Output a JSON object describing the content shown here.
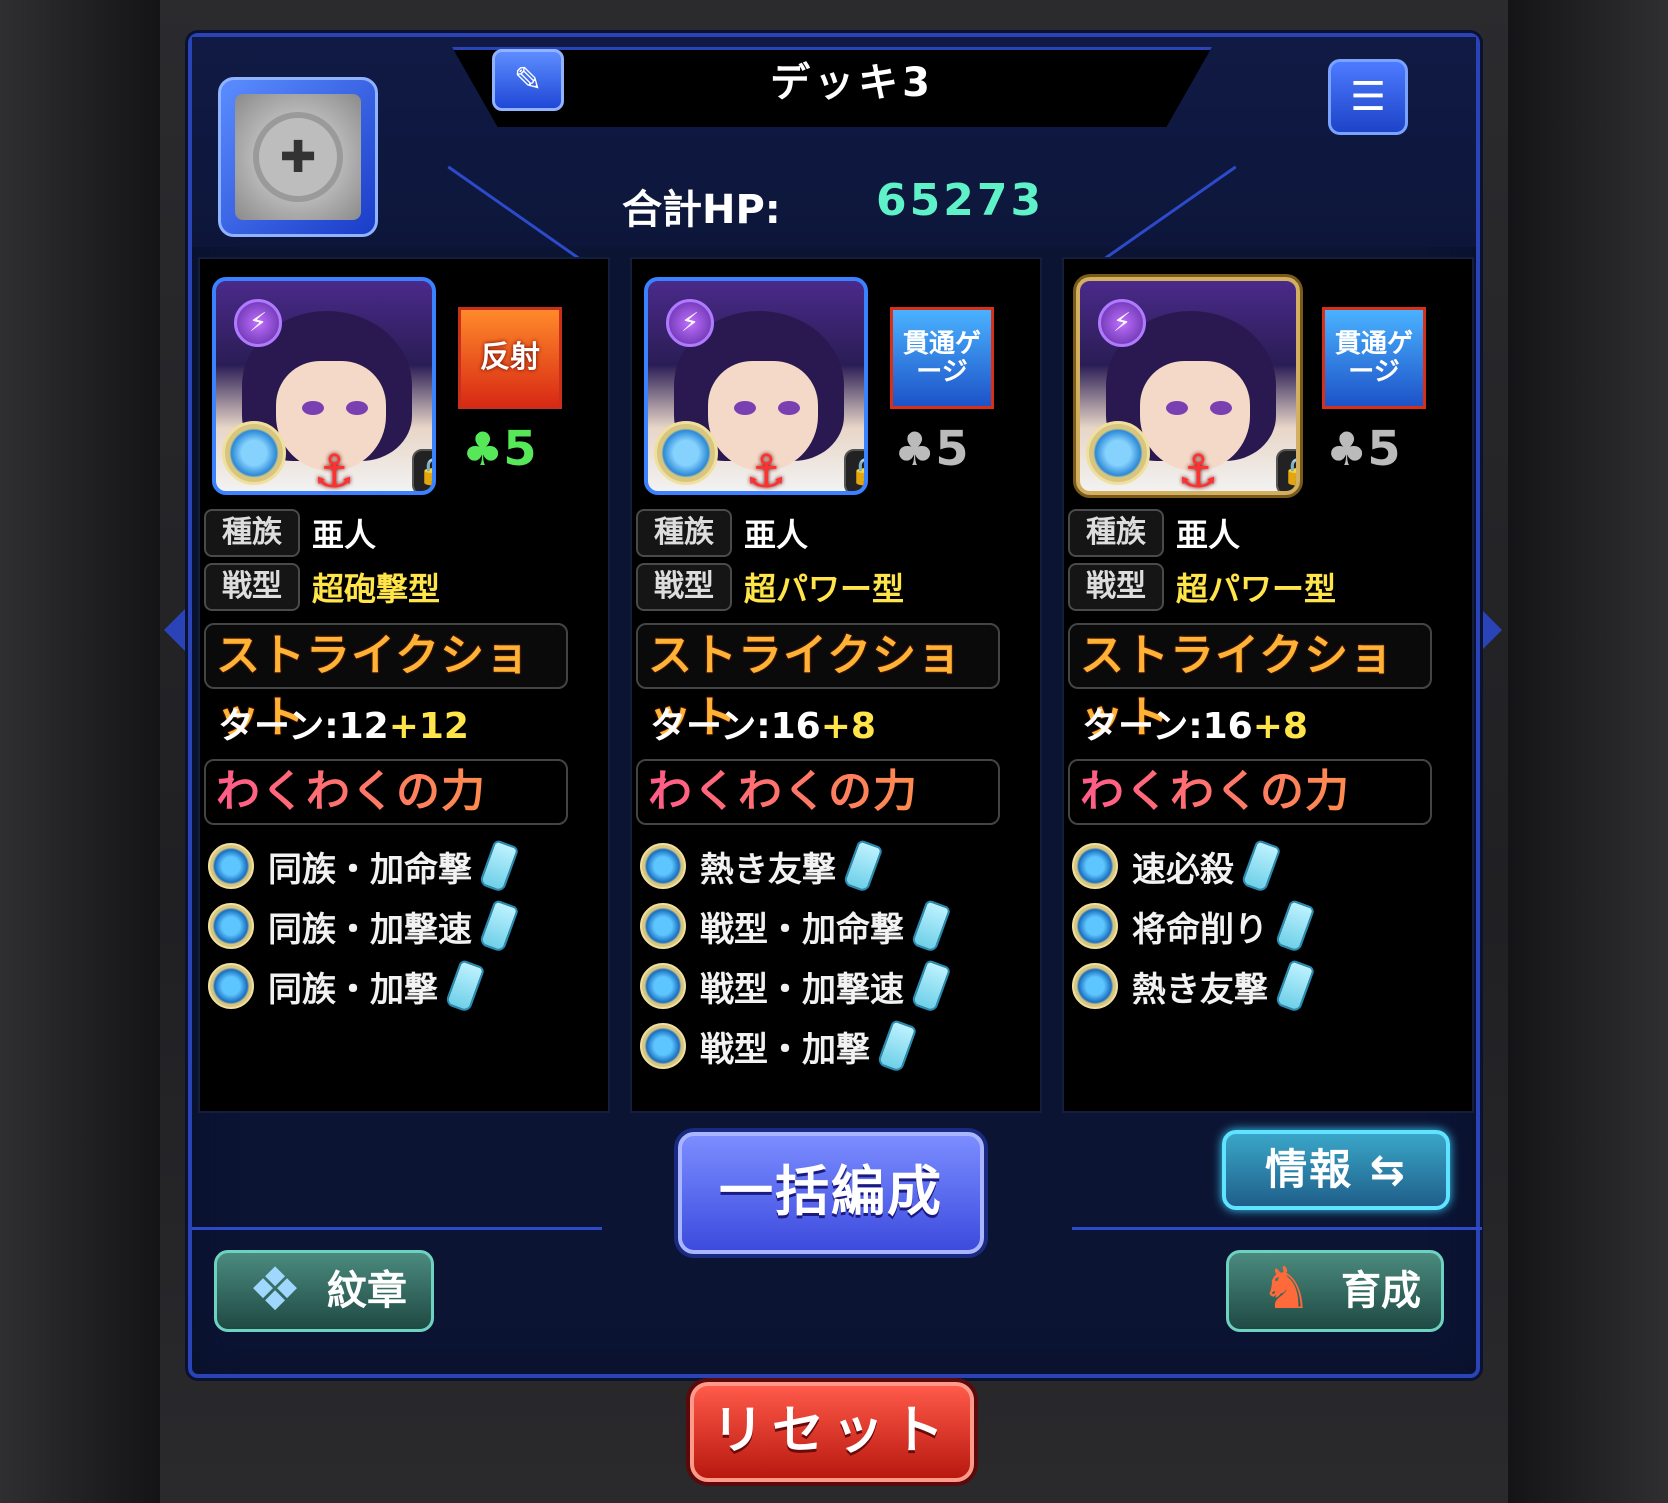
{
  "deck": {
    "title": "デッキ3",
    "hp_label": "合計HP:",
    "hp_value": "65273"
  },
  "cards": [
    {
      "gimmick": "反射",
      "gimmick_type": "reflect",
      "luck": "5",
      "luck_color": "#57e85a",
      "race_tag": "種族",
      "race": "亜人",
      "type_tag": "戦型",
      "type": "超砲撃型",
      "ss_label": "ストライクショット",
      "turn_base": "ターン:12",
      "turn_plus": "+12",
      "waku_label": "わくわくの力",
      "fruits": [
        "同族・加命撃",
        "同族・加撃速",
        "同族・加撃"
      ]
    },
    {
      "gimmick": "貫通ゲージ",
      "gimmick_type": "pierce",
      "luck": "5",
      "luck_color": "#bbbbbb",
      "race_tag": "種族",
      "race": "亜人",
      "type_tag": "戦型",
      "type": "超パワー型",
      "ss_label": "ストライクショット",
      "turn_base": "ターン:16",
      "turn_plus": "+8",
      "waku_label": "わくわくの力",
      "fruits": [
        "熱き友撃",
        "戦型・加命撃",
        "戦型・加撃速",
        "戦型・加撃"
      ]
    },
    {
      "gimmick": "貫通ゲージ",
      "gimmick_type": "pierce",
      "luck": "5",
      "luck_color": "#bbbbbb",
      "race_tag": "種族",
      "race": "亜人",
      "type_tag": "戦型",
      "type": "超パワー型",
      "ss_label": "ストライクショット",
      "turn_base": "ターン:16",
      "turn_plus": "+8",
      "waku_label": "わくわくの力",
      "fruits": [
        "速必殺",
        "将命削り",
        "熱き友撃"
      ]
    }
  ],
  "buttons": {
    "bulk": "一括編成",
    "info": "情報",
    "emblem": "紋章",
    "grow": "育成",
    "reset": "リセット"
  },
  "icons": {
    "edit": "pencil-icon",
    "menu": "list-icon",
    "favorite": "heart-plus-icon"
  }
}
